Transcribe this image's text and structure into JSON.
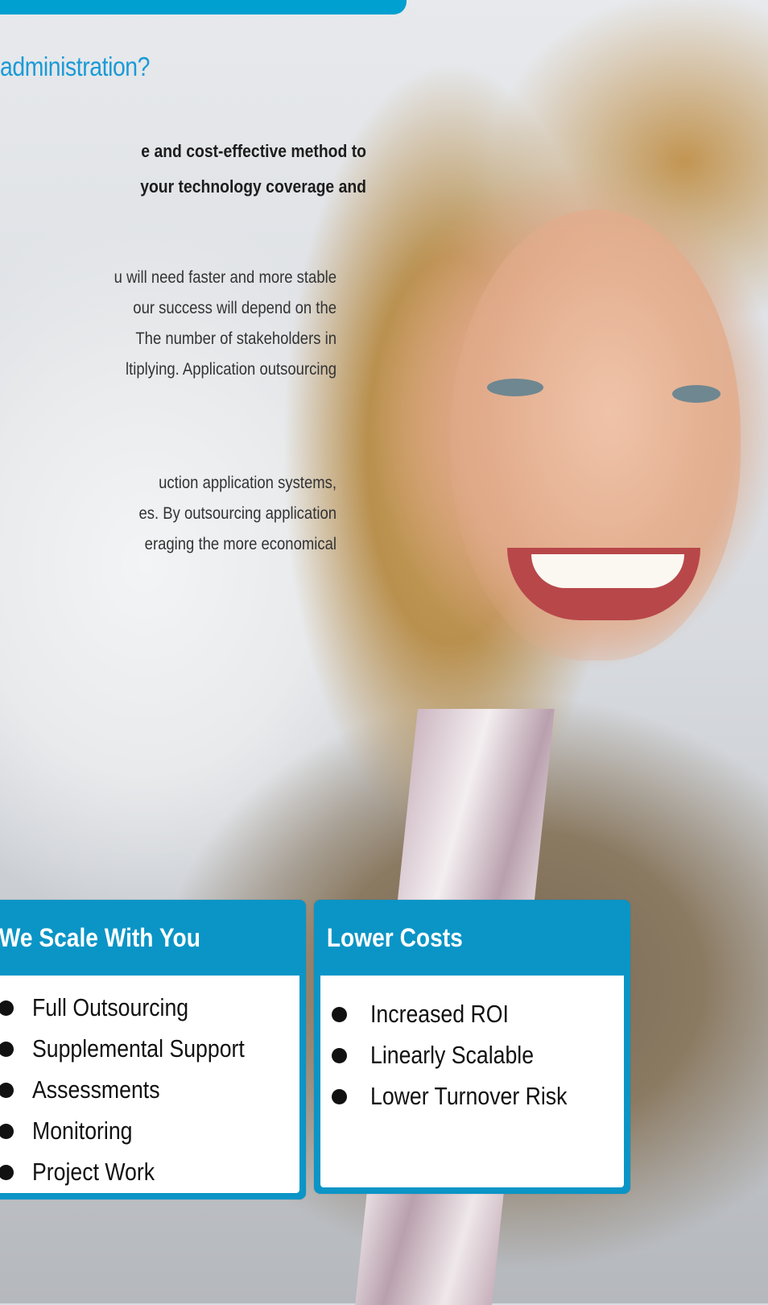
{
  "heading": "administration?",
  "intro_lines": [
    "e and cost-effective method to",
    "your technology coverage and"
  ],
  "paragraph1_lines": [
    "u will need faster and more stable",
    "our success will depend on the",
    "The number of stakeholders in",
    "ltiplying. Application outsourcing"
  ],
  "paragraph2_lines": [
    "uction application systems,",
    "es. By outsourcing application",
    "eraging the more economical"
  ],
  "boxes": {
    "scale": {
      "title": "We Scale With You",
      "items": [
        "Full Outsourcing",
        "Supplemental Support",
        "Assessments",
        "Monitoring",
        "Project Work"
      ]
    },
    "costs": {
      "title": "Lower Costs",
      "items": [
        "Increased ROI",
        "Linearly Scalable",
        "Lower Turnover Risk"
      ]
    }
  },
  "colors": {
    "accent_blue": "#00a0d0",
    "heading_blue": "#1b9ad6",
    "box_blue": "#0a95c6"
  }
}
